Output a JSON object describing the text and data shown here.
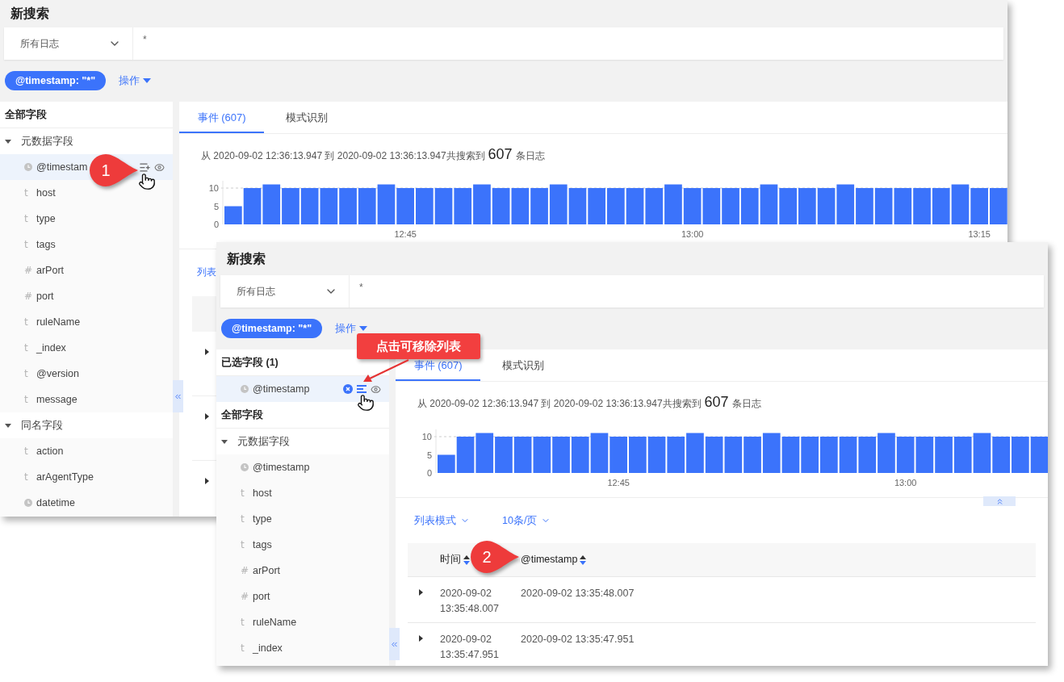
{
  "windows": [
    {
      "title": "新搜索",
      "source": "所有日志",
      "query": "*",
      "filter_chip": "@timestamp: \"*\"",
      "actions_menu": "操作",
      "sidebar": {
        "groups": [
          {
            "heading": "全部字段",
            "sections": [
              {
                "label": "元数据字段",
                "expanded": true,
                "fields": [
                  {
                    "name": "@timestam",
                    "kind": "date",
                    "selected": true,
                    "in_table": false
                  },
                  {
                    "name": "host",
                    "kind": "text",
                    "glyph": "t",
                    "selected": false
                  },
                  {
                    "name": "type",
                    "kind": "text",
                    "glyph": "t",
                    "selected": false
                  },
                  {
                    "name": "tags",
                    "kind": "text",
                    "glyph": "t",
                    "selected": false
                  },
                  {
                    "name": "arPort",
                    "kind": "number",
                    "glyph": "#",
                    "selected": false
                  },
                  {
                    "name": "port",
                    "kind": "number",
                    "glyph": "#",
                    "selected": false
                  },
                  {
                    "name": "ruleName",
                    "kind": "text",
                    "glyph": "t",
                    "selected": false
                  },
                  {
                    "name": "_index",
                    "kind": "text",
                    "glyph": "t",
                    "selected": false
                  },
                  {
                    "name": "@version",
                    "kind": "text",
                    "glyph": "t",
                    "selected": false
                  },
                  {
                    "name": "message",
                    "kind": "text",
                    "glyph": "t",
                    "selected": false
                  }
                ]
              },
              {
                "label": "同名字段",
                "expanded": true,
                "fields": [
                  {
                    "name": "action",
                    "kind": "text",
                    "glyph": "t",
                    "selected": false
                  },
                  {
                    "name": "arAgentType",
                    "kind": "text",
                    "glyph": "t",
                    "selected": false
                  },
                  {
                    "name": "datetime",
                    "kind": "date",
                    "selected": false
                  }
                ]
              }
            ]
          }
        ]
      },
      "tabs": [
        {
          "label": "事件 (607)",
          "selected": true
        },
        {
          "label": "模式识别",
          "selected": false
        }
      ],
      "summary": {
        "prefix": "从 2020-09-02 12:36:13.947 到 2020-09-02 13:36:13.947共搜索到",
        "count": "607",
        "suffix": "条日志"
      },
      "chart_data": {
        "type": "bar",
        "categories": [
          null,
          null,
          null,
          null,
          null,
          null,
          null,
          null,
          null,
          "12:45",
          null,
          null,
          null,
          null,
          null,
          null,
          null,
          null,
          null,
          null,
          null,
          null,
          null,
          null,
          "13:00",
          null,
          null,
          null,
          null,
          null,
          null,
          null,
          null,
          null,
          null,
          null,
          null,
          null,
          null,
          "13:15",
          null
        ],
        "values": [
          5,
          10,
          11,
          10,
          10,
          10,
          10,
          10,
          11,
          10,
          10,
          10,
          10,
          11,
          10,
          10,
          10,
          11,
          10,
          10,
          10,
          10,
          10,
          11,
          10,
          10,
          10,
          10,
          11,
          10,
          10,
          10,
          11,
          10,
          10,
          10,
          10,
          10,
          11,
          10,
          10
        ],
        "ylim": [
          0,
          12
        ],
        "yticks": [
          0,
          5,
          10
        ]
      },
      "table": {
        "view_mode": "列表",
        "rows": [
          {
            "expanded": false
          },
          {
            "expanded": false
          },
          {
            "expanded": false
          }
        ]
      }
    },
    {
      "title": "新搜索",
      "source": "所有日志",
      "query": "*",
      "filter_chip": "@timestamp: \"*\"",
      "actions_menu": "操作",
      "sidebar": {
        "groups": [
          {
            "heading": "已选字段 (1)",
            "fields": [
              {
                "name": "@timestamp",
                "kind": "date",
                "selected": true,
                "in_table": true
              }
            ]
          },
          {
            "heading": "全部字段",
            "sections": [
              {
                "label": "元数据字段",
                "expanded": true,
                "fields": [
                  {
                    "name": "@timestamp",
                    "kind": "date",
                    "selected": false
                  },
                  {
                    "name": "host",
                    "kind": "text",
                    "glyph": "t",
                    "selected": false
                  },
                  {
                    "name": "type",
                    "kind": "text",
                    "glyph": "t",
                    "selected": false
                  },
                  {
                    "name": "tags",
                    "kind": "text",
                    "glyph": "t",
                    "selected": false
                  },
                  {
                    "name": "arPort",
                    "kind": "number",
                    "glyph": "#",
                    "selected": false
                  },
                  {
                    "name": "port",
                    "kind": "number",
                    "glyph": "#",
                    "selected": false
                  },
                  {
                    "name": "ruleName",
                    "kind": "text",
                    "glyph": "t",
                    "selected": false
                  },
                  {
                    "name": "_index",
                    "kind": "text",
                    "glyph": "t",
                    "selected": false
                  }
                ]
              }
            ]
          }
        ]
      },
      "tabs": [
        {
          "label": "事件 (607)",
          "selected": true
        },
        {
          "label": "模式识别",
          "selected": false
        }
      ],
      "summary": {
        "prefix": "从 2020-09-02 12:36:13.947 到 2020-09-02 13:36:13.947共搜索到",
        "count": "607",
        "suffix": "条日志"
      },
      "chart_data": {
        "type": "bar",
        "categories": [
          null,
          null,
          null,
          null,
          null,
          null,
          null,
          null,
          null,
          "12:45",
          null,
          null,
          null,
          null,
          null,
          null,
          null,
          null,
          null,
          null,
          null,
          null,
          null,
          null,
          "13:00",
          null,
          null,
          null,
          null,
          null,
          null,
          null
        ],
        "values": [
          5,
          10,
          11,
          10,
          10,
          10,
          10,
          10,
          11,
          10,
          10,
          10,
          10,
          11,
          10,
          10,
          10,
          11,
          10,
          10,
          10,
          10,
          10,
          11,
          10,
          10,
          10,
          10,
          11,
          10,
          10,
          10
        ],
        "ylim": [
          0,
          12
        ],
        "yticks": [
          0,
          5,
          10
        ]
      },
      "table": {
        "view_mode": "列表模式",
        "page_size": "10条/页",
        "columns": [
          {
            "label": "时间"
          },
          {
            "label": "@timestamp"
          }
        ],
        "rows": [
          {
            "expanded": false,
            "cells": [
              "2020-09-02 13:35:48.007",
              "2020-09-02 13:35:48.007"
            ]
          },
          {
            "expanded": false,
            "cells": [
              "2020-09-02 13:35:47.951",
              "2020-09-02 13:35:47.951"
            ]
          }
        ]
      }
    }
  ],
  "annotations": [
    {
      "kind": "badge",
      "text": "1"
    },
    {
      "kind": "label",
      "text": "点击可移除列表"
    },
    {
      "kind": "badge",
      "text": "2"
    }
  ]
}
